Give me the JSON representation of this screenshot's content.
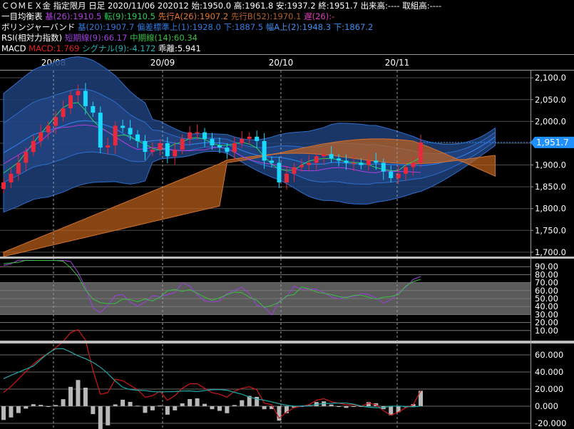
{
  "header": {
    "row1": {
      "symbol": "ＣＯＭＥＸ金 指定限月 日足",
      "date": "2020/11/06",
      "contract": "202012",
      "ohlc": "始:1950.0 高:1961.8 安:1937.2 終:1951.7",
      "volume": "出来高:----",
      "open_interest": "取組高:----"
    },
    "row2": {
      "label": "一目均衡表",
      "base": "基(26):1910.5",
      "conv": "転(9):1910.5",
      "spanA": "先行A(26):1907.2",
      "spanB": "先行B(52):1970.1",
      "lag": "遅(26):-"
    },
    "row3": {
      "label": "ボリンジャーバンド",
      "base": "基(20):1907.7",
      "upper": "偏差標準上(1):1928.0 下:1887.5",
      "width": "幅A上(2):1948.3 下:1867.2"
    },
    "row4": {
      "label": "RSI(相対力指数)",
      "short": "短期線(9):66.17",
      "mid": "中期線(14):60.34"
    },
    "row5": {
      "label": "MACD",
      "macd": "MACD:1.769",
      "signal": "シグナル(9):-4.172",
      "dev": "乖離:5.941"
    }
  },
  "colors": {
    "up": "#e8283c",
    "down": "#19d9ff",
    "bg": "#000000",
    "grid": "#4a4a4a",
    "bb_fill": "#1f3f79",
    "bb_line": "#2f6ecb",
    "cloud_bear": "#c2621d",
    "cloud_bull": "#4a5a8a",
    "tenkan": "#2bd05a",
    "kijun": "#b040e0",
    "rsi_short": "#a040e0",
    "rsi_mid": "#38c040",
    "macd": "#d01818",
    "signal": "#20a8a8",
    "price_tag": "#1e90ff"
  },
  "chart_data": [
    {
      "type": "candlestick",
      "title": "",
      "x_labels": [
        "20/08",
        "20/09",
        "20/10",
        "20/11"
      ],
      "y_ticks": [
        "2,100.0",
        "2,050.0",
        "2,000.0",
        "1,950.0",
        "1,900.0",
        "1,850.0",
        "1,800.0",
        "1,750.0",
        "1,700.0"
      ],
      "ylim": [
        1690,
        2115
      ],
      "last_price": "1,951.7",
      "approx_closes": [
        1860,
        1880,
        1905,
        1930,
        1955,
        1975,
        1990,
        2010,
        2030,
        2060,
        2070,
        2035,
        2020,
        1940,
        1945,
        1990,
        1985,
        1970,
        1955,
        1930,
        1935,
        1950,
        1920,
        1935,
        1960,
        1975,
        1975,
        1960,
        1945,
        1940,
        1930,
        1950,
        1960,
        1965,
        1955,
        1910,
        1905,
        1860,
        1880,
        1895,
        1900,
        1905,
        1920,
        1925,
        1915,
        1910,
        1905,
        1905,
        1900,
        1910,
        1905,
        1885,
        1870,
        1880,
        1895,
        1905,
        1951.7
      ]
    },
    {
      "type": "line",
      "title": "RSI",
      "y_ticks": [
        "90.00",
        "80.00",
        "70.00",
        "60.00",
        "50.00",
        "40.00",
        "30.00",
        "20.00",
        "10.00"
      ],
      "ylim": [
        0,
        100
      ]
    },
    {
      "type": "bar",
      "title": "MACD",
      "y_ticks": [
        "60.000",
        "40.000",
        "20.000",
        "0.000",
        "-20.000"
      ],
      "ylim": [
        -25,
        70
      ]
    }
  ]
}
